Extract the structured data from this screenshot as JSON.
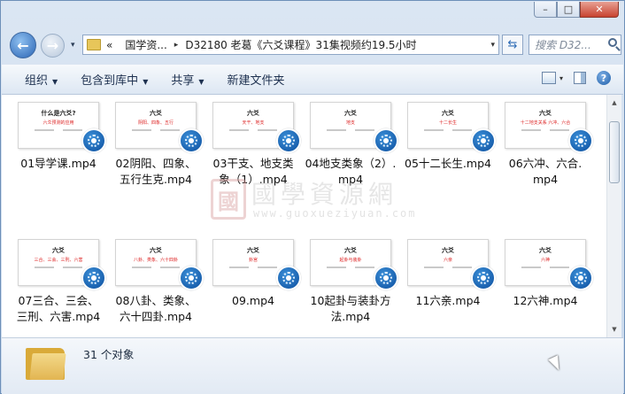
{
  "window": {
    "minimize_label": "–",
    "maximize_label": "□",
    "close_label": "✕"
  },
  "nav": {
    "back_label": "←",
    "forward_label": "→",
    "history_dropdown": "▾",
    "address": {
      "overflow": "«",
      "crumbs": [
        "国学资...",
        "D32180 老葛《六爻课程》31集视频约19.5小时"
      ],
      "separator": "▸",
      "dropdown": "▾"
    },
    "refresh_label": "⇆",
    "search_placeholder": "搜索 D32..."
  },
  "toolbar": {
    "items": [
      "组织",
      "包含到库中",
      "共享",
      "新建文件夹"
    ],
    "dropdown_arrow": "▼",
    "help_label": "?"
  },
  "files": [
    {
      "name": "01导学课.mp4",
      "thumb_title": "什么是六爻?",
      "thumb_red": "六爻预测的应用"
    },
    {
      "name": "02阴阳、四象、\n五行生克.mp4",
      "thumb_title": "六爻",
      "thumb_red": "阴阳、四象、五行"
    },
    {
      "name": "03干支、地支类\n象（1）.mp4",
      "thumb_title": "六爻",
      "thumb_red": "天干、地支"
    },
    {
      "name": "04地支类象（2）.\nmp4",
      "thumb_title": "六爻",
      "thumb_red": "地支"
    },
    {
      "name": "05十二长生.mp4",
      "thumb_title": "六爻",
      "thumb_red": "十二长生"
    },
    {
      "name": "06六冲、六合.\nmp4",
      "thumb_title": "六爻",
      "thumb_red": "十二地支关系 六冲、六合"
    },
    {
      "name": "07三合、三会、\n三刑、六害.mp4",
      "thumb_title": "六爻",
      "thumb_red": "三合、三会、三刑、六害"
    },
    {
      "name": "08八卦、类象、\n六十四卦.mp4",
      "thumb_title": "六爻",
      "thumb_red": "八卦、类象、六十四卦"
    },
    {
      "name": "09.mp4",
      "thumb_title": "六爻",
      "thumb_red": "卦宫"
    },
    {
      "name": "10起卦与装卦方\n法.mp4",
      "thumb_title": "六爻",
      "thumb_red": "起卦与装卦"
    },
    {
      "name": "11六亲.mp4",
      "thumb_title": "六爻",
      "thumb_red": "六亲"
    },
    {
      "name": "12六神.mp4",
      "thumb_title": "六爻",
      "thumb_red": "六神"
    }
  ],
  "watermark": {
    "seal": "國",
    "title": "國學資源網",
    "url": "www.guoxueziyuan.com"
  },
  "status": {
    "count_text": "31 个对象"
  },
  "colors": {
    "accent": "#2a64b4",
    "frame": "#c9d9ec",
    "badge": "#0d4f9e"
  }
}
